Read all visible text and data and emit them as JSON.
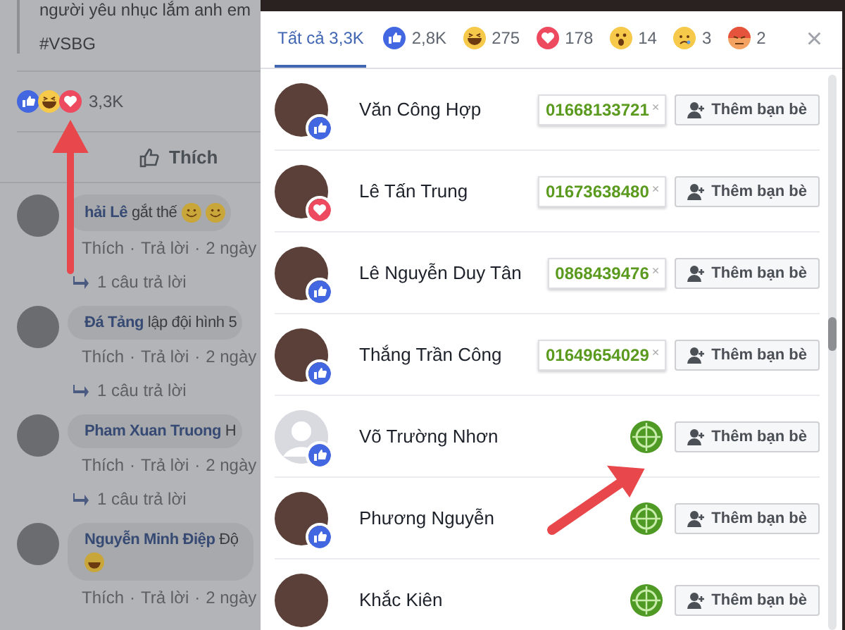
{
  "post": {
    "text": "người yêu nhục lắm anh em",
    "hashtag": "#VSBG",
    "reactions": [
      {
        "kind": "like"
      },
      {
        "kind": "haha"
      },
      {
        "kind": "love"
      }
    ],
    "reaction_count": "3,3K",
    "like_button": "Thích"
  },
  "comments": [
    {
      "name": "hải Lê",
      "text": "gắt thế",
      "emoji": [
        {
          "kind": "smile"
        },
        {
          "kind": "smile"
        }
      ],
      "actions": [
        "Thích",
        "·",
        "Trả lời",
        "·",
        "2 ngày"
      ],
      "replies": "1 câu trả lời"
    },
    {
      "name": "Đá Tảng",
      "text": "lập đội hình 5",
      "actions": [
        "Thích",
        "·",
        "Trả lời",
        "·",
        "2 ngày"
      ],
      "replies": "1 câu trả lời"
    },
    {
      "name": "Pham Xuan Truong",
      "text": "H",
      "actions": [
        "Thích",
        "·",
        "Trả lời",
        "·",
        "2 ngày"
      ],
      "replies": "1 câu trả lời"
    },
    {
      "name": "Nguyễn Minh Điệp",
      "text": "Độ",
      "emoji": [
        {
          "kind": "laugh"
        }
      ],
      "actions": [
        "Thích",
        "·",
        "Trả lời",
        "·",
        "2 ngày"
      ]
    }
  ],
  "dialog": {
    "tabs": [
      {
        "kind": "all",
        "label": "Tất cả 3,3K",
        "selected": true
      },
      {
        "kind": "like",
        "label": "2,8K",
        "selected": false
      },
      {
        "kind": "haha",
        "label": "275",
        "selected": false
      },
      {
        "kind": "love",
        "label": "178",
        "selected": false
      },
      {
        "kind": "wow",
        "label": "14",
        "selected": false
      },
      {
        "kind": "sad",
        "label": "3",
        "selected": false
      },
      {
        "kind": "angry",
        "label": "2",
        "selected": false
      }
    ],
    "close": "×",
    "people": [
      {
        "name": "Văn Công Hợp",
        "avatar": {
          "kind": "photo"
        },
        "reaction": {
          "kind": "like"
        },
        "contact": {
          "kind": "phone",
          "value": "01668133721",
          "remove": "×"
        },
        "button": "Thêm bạn bè"
      },
      {
        "name": "Lê Tấn Trung",
        "avatar": {
          "kind": "photo"
        },
        "reaction": {
          "kind": "love"
        },
        "contact": {
          "kind": "phone",
          "value": "01673638480",
          "remove": "×"
        },
        "button": "Thêm bạn bè"
      },
      {
        "name": "Lê Nguyễn Duy Tân",
        "avatar": {
          "kind": "photo"
        },
        "reaction": {
          "kind": "like"
        },
        "contact": {
          "kind": "phone",
          "value": "0868439476",
          "remove": "×"
        },
        "button": "Thêm bạn bè"
      },
      {
        "name": "Thắng Trần Công",
        "avatar": {
          "kind": "photo"
        },
        "reaction": {
          "kind": "like"
        },
        "contact": {
          "kind": "phone",
          "value": "01649654029",
          "remove": "×"
        },
        "button": "Thêm bạn bè"
      },
      {
        "name": "Võ Trường Nhơn",
        "avatar": {
          "kind": "default"
        },
        "reaction": {
          "kind": "like"
        },
        "contact": {
          "kind": "target"
        },
        "button": "Thêm bạn bè"
      },
      {
        "name": "Phương Nguyễn",
        "avatar": {
          "kind": "photo"
        },
        "reaction": {
          "kind": "like"
        },
        "contact": {
          "kind": "target"
        },
        "button": "Thêm bạn bè"
      },
      {
        "name": "Khắc Kiên",
        "avatar": {
          "kind": "photo"
        },
        "contact": {
          "kind": "target"
        },
        "button": "Thêm bạn bè"
      }
    ]
  }
}
